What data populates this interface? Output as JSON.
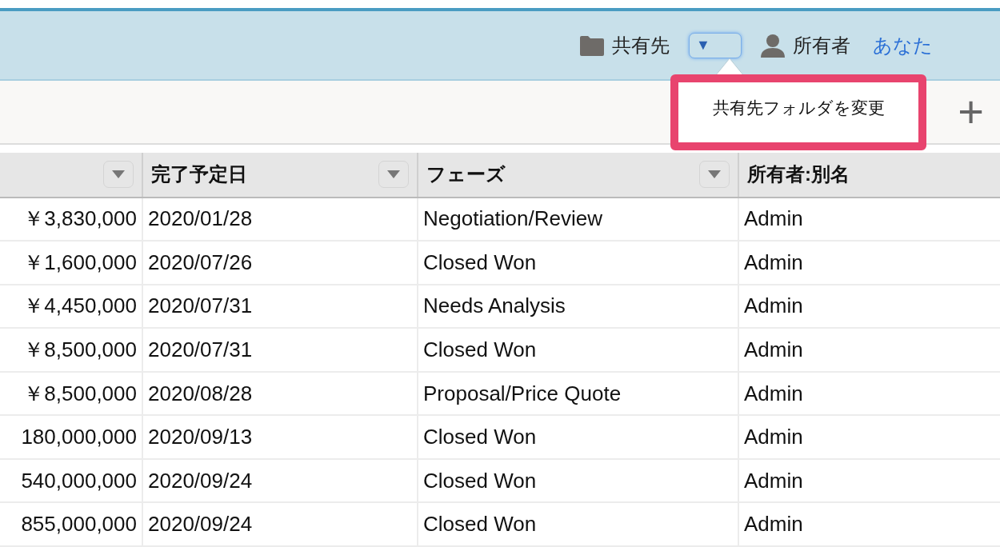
{
  "header": {
    "folder_label": "共有先",
    "folder_button": {
      "glyph": "▼",
      "focused": true
    },
    "owner_label": "所有者",
    "owner_value": "あなた"
  },
  "popover": {
    "item": "共有先フォルダを変更",
    "highlighted": true
  },
  "toolbar": {
    "add_glyph": "+"
  },
  "table": {
    "columns": [
      {
        "menu": true
      },
      {
        "label": "完了予定日",
        "menu": true
      },
      {
        "label": "フェーズ",
        "menu": true
      },
      {
        "label": "所有者:別名",
        "menu": false
      }
    ],
    "rows": [
      [
        "￥3,830,000",
        "2020/01/28",
        "Negotiation/Review",
        "Admin"
      ],
      [
        "￥1,600,000",
        "2020/07/26",
        "Closed Won",
        "Admin"
      ],
      [
        "￥4,450,000",
        "2020/07/31",
        "Needs Analysis",
        "Admin"
      ],
      [
        "￥8,500,000",
        "2020/07/31",
        "Closed Won",
        "Admin"
      ],
      [
        "￥8,500,000",
        "2020/08/28",
        "Proposal/Price Quote",
        "Admin"
      ],
      [
        "180,000,000",
        "2020/09/13",
        "Closed Won",
        "Admin"
      ],
      [
        "540,000,000",
        "2020/09/24",
        "Closed Won",
        "Admin"
      ],
      [
        "855,000,000",
        "2020/09/24",
        "Closed Won",
        "Admin"
      ]
    ]
  }
}
